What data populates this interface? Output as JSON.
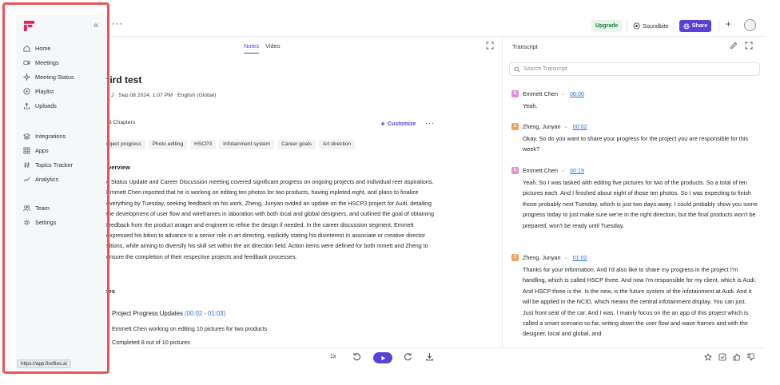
{
  "app": {
    "status_url": "https://app.fireflies.ai",
    "brand_color": "#5b3fd6",
    "logo_color": "#e0245e"
  },
  "sidebar": {
    "collapse_icon": "collapse-left-icon",
    "groups": [
      [
        {
          "label": "Home",
          "icon": "home-icon"
        },
        {
          "label": "Meetings",
          "icon": "video-icon"
        },
        {
          "label": "Meeting Status",
          "icon": "sparkle-icon"
        },
        {
          "label": "Playlist",
          "icon": "playlist-icon"
        },
        {
          "label": "Uploads",
          "icon": "upload-icon"
        }
      ],
      [
        {
          "label": "Integrations",
          "icon": "layers-icon"
        },
        {
          "label": "Apps",
          "icon": "grid-icon"
        },
        {
          "label": "Topics Tracker",
          "icon": "hash-icon"
        },
        {
          "label": "Analytics",
          "icon": "chart-icon"
        }
      ],
      [
        {
          "label": "Team",
          "icon": "team-icon"
        },
        {
          "label": "Settings",
          "icon": "gear-icon"
        }
      ]
    ]
  },
  "topbar": {
    "upgrade_label": "Upgrade",
    "soundbite_label": "Soundbite",
    "share_label": "Share"
  },
  "notes": {
    "tabs": [
      {
        "label": "Notes",
        "active": true
      },
      {
        "label": "Video",
        "active": false
      }
    ],
    "title": "hird test",
    "meta": {
      "initial": "J",
      "date": "Sep 08 2024, 1:07 PM",
      "language": "English (Global)"
    },
    "chapters_label": "3 Chapters",
    "customize_label": "Customize",
    "chips": [
      "roject progress",
      "Photo editing",
      "HSCP3",
      "Infotainment system",
      "Career goals",
      "Art direction"
    ],
    "overview_heading": "verview",
    "overview_text": "e Status Update and Career Discussion meeting covered significant progress on ongoing projects and individual reer aspirations. Emmett Chen reported that he is working on editing ten photos for two products, having mpleted eight, and plans to finalize everything by Tuesday, seeking feedback on his work. Zheng, Junyan ovided an update on the HSCP3 project for Audi, detailing the development of user flow and wireframes in laboration with both local and global designers, and outlined the goal of obtaining feedback from the product anager and engineer to refine the design if needed. In the career discussion segment, Emmett expressed his bition to advance to a senior role in art directing, explicitly stating his disinterest in associate or creative director sitions, while aiming to diversify his skill set within the art direction field. Action items were defined for both mmett and Zheng to ensure the completion of their respective projects and feedback processes.",
    "notes_heading": "tes",
    "section_title": "Project Progress Updates",
    "section_range": "(00:02 - 01:03)",
    "bullets": [
      "Emmett Chen working on editing 10 pictures for two products",
      "Completed 8 out of 10 pictures"
    ]
  },
  "player": {
    "speed": "1x"
  },
  "transcript": {
    "title": "Transcript",
    "search_placeholder": "Search Transcript",
    "entries": [
      {
        "initial": "E",
        "speaker": "Emmett Chen",
        "time": "00:00",
        "color": "#e58fd5",
        "text": "Yeah."
      },
      {
        "initial": "Z",
        "speaker": "Zheng, Junyan",
        "time": "00:02",
        "color": "#f0a35a",
        "text": "Okay. So do you want to share your progress for the project you are responsible for this week?"
      },
      {
        "initial": "E",
        "speaker": "Emmett Chen",
        "time": "00:19",
        "color": "#e58fd5",
        "text": "Yeah. So I was tasked with editing five pictures for two of the products. So a total of ten pictures each. And I finished about eight of those ten photos. So I was expecting to finish those probably next Tuesday, which is just two days away. I could probably show you some progress today to just make sure we're in the right direction, but the final products won't be prepared, won't be ready until Tuesday."
      },
      {
        "initial": "Z",
        "speaker": "Zheng, Junyan",
        "time": "01:02",
        "color": "#f0a35a",
        "text": "Thanks for your information. And I'd also like to share my progress in the project I'm handling, which is called HSCP three. And now I'm responsible for my client, which is Audi. And HSCP three is the. Is the new, is the future system of the infotainment at Audi. And it will be applied in the NCID, which means the central infotainment display. You can just. Just front seat of the car. And I was. I mainly focus on the an app of this project which is called a smart scenario so far, writing down the user flow and wave frames and with the designer, local and global, and"
      }
    ]
  }
}
